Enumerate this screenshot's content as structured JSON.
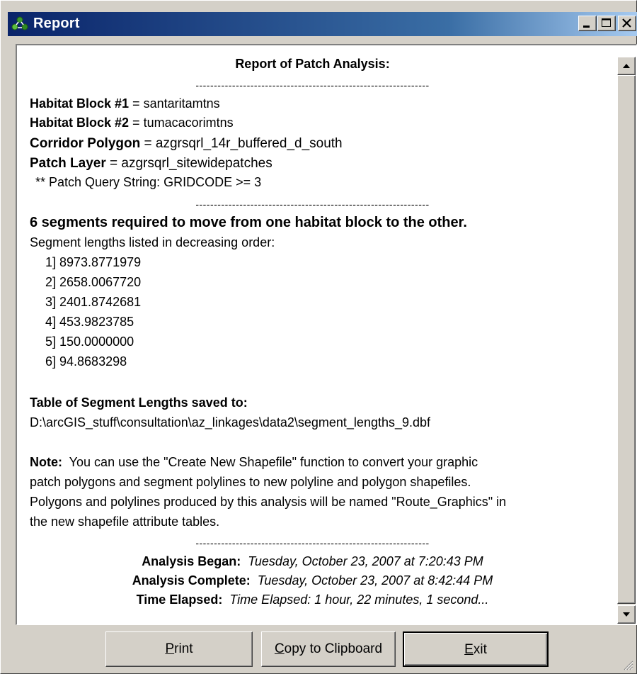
{
  "window": {
    "title": "Report"
  },
  "report": {
    "heading": "Report of Patch Analysis:",
    "divider": "----------------------------------------------------------------",
    "blocks": [
      {
        "label": "Habitat Block #1",
        "sep": " = ",
        "value": "santaritamtns"
      },
      {
        "label": "Habitat Block #2",
        "sep": " = ",
        "value": "tumacacorimtns"
      },
      {
        "label": "Corridor Polygon",
        "sep": " = ",
        "value": "azgrsqrl_14r_buffered_d_south"
      },
      {
        "label": "Patch Layer",
        "sep": " = ",
        "value": "azgrsqrl_sitewidepatches"
      }
    ],
    "query_string": "** Patch Query String:  GRIDCODE >= 3",
    "segments_summary": "6 segments required to move from one habitat block to the other.",
    "segments_intro": "Segment lengths listed in decreasing order:",
    "segments": [
      "1] 8973.8771979",
      "2] 2658.0067720",
      "3] 2401.8742681",
      "4] 453.9823785",
      "5] 150.0000000",
      "6] 94.8683298"
    ],
    "table_heading": "Table of Segment Lengths saved to:",
    "table_path": "D:\\arcGIS_stuff\\consultation\\az_linkages\\data2\\segment_lengths_9.dbf",
    "note_label": "Note:",
    "note_lines": [
      "  You can use the \"Create New Shapefile\" function to convert your graphic",
      "patch polygons and segment polylines to new polyline and polygon shapefiles.",
      "Polygons and polylines produced by this analysis will be named \"Route_Graphics\" in",
      "the new shapefile attribute tables."
    ],
    "times": [
      {
        "label": "Analysis Began:",
        "value": "Tuesday, October 23, 2007 at 7:20:43 PM"
      },
      {
        "label": "Analysis Complete:",
        "value": "Tuesday, October 23, 2007 at 8:42:44 PM"
      },
      {
        "label": "Time Elapsed:",
        "value": "Time Elapsed: 1 hour, 22 minutes, 1 second..."
      }
    ]
  },
  "buttons": {
    "print_mnemonic": "P",
    "print_rest": "rint",
    "copy_mnemonic": "C",
    "copy_rest": "opy to Clipboard",
    "exit_mnemonic": "E",
    "exit_rest": "xit"
  },
  "colors": {
    "titlebar_start": "#0a246a",
    "titlebar_end": "#a6caf0",
    "face": "#d4d0c8"
  },
  "icons": {
    "app": "green-molecule-icon",
    "minimize": "minimize-icon",
    "maximize": "maximize-icon",
    "close": "close-icon"
  }
}
